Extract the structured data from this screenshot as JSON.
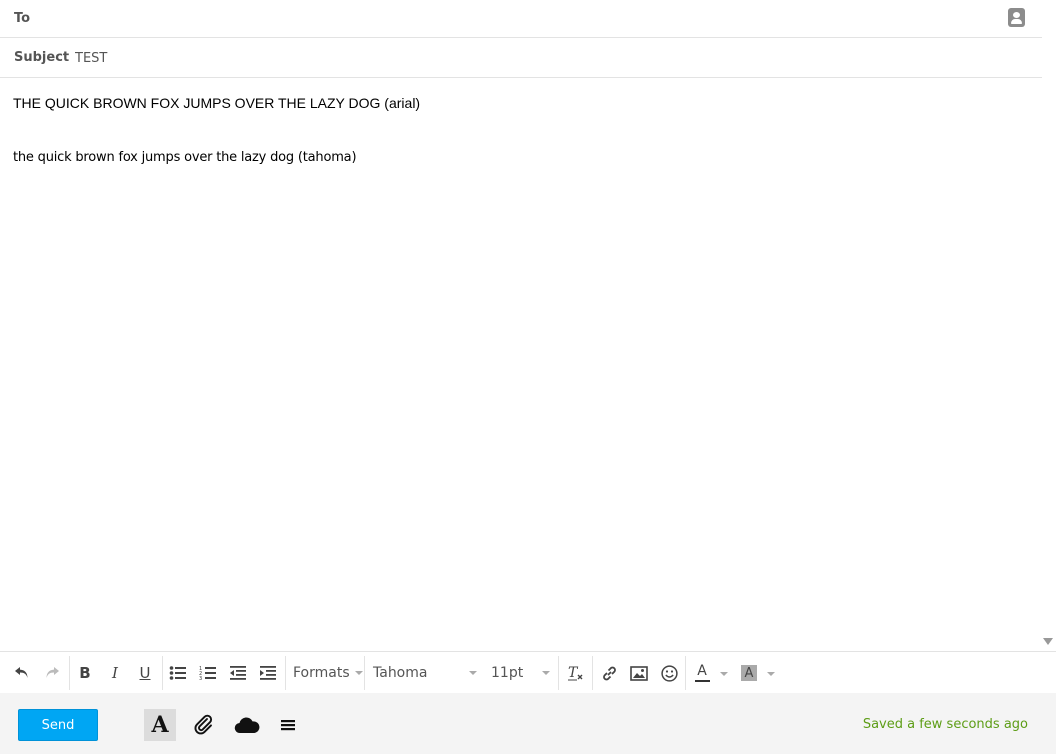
{
  "header": {
    "to_label": "To",
    "to_value": "",
    "subject_label": "Subject",
    "subject_value": "TEST"
  },
  "body": {
    "line1": "THE QUICK BROWN FOX JUMPS OVER THE LAZY DOG (arial)",
    "line2": "the quick brown fox jumps over the lazy dog (tahoma)"
  },
  "toolbar": {
    "bold_label": "B",
    "italic_label": "I",
    "underline_label": "U",
    "formats_label": "Formats",
    "font_family_value": "Tahoma",
    "font_size_value": "11pt",
    "text_color_label": "A",
    "background_color_label": "A",
    "text_color": "#333333",
    "background_color_swatch": "#aaaaaa"
  },
  "footer": {
    "send_label": "Send",
    "format_toggle_label": "A",
    "saved_status": "Saved a few seconds ago",
    "send_color": "#00a6f3",
    "saved_color": "#5d9d16"
  }
}
